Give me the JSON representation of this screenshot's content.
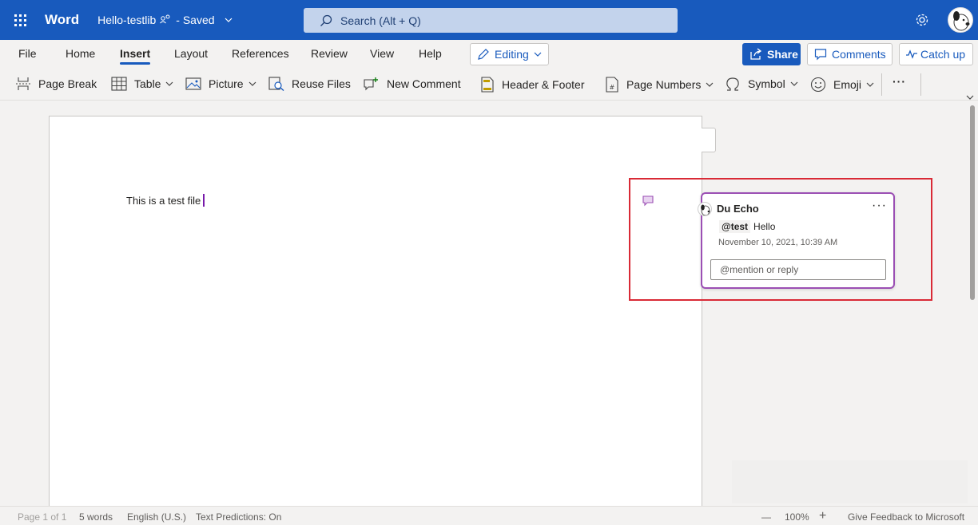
{
  "titlebar": {
    "app_name": "Word",
    "doc_name": "Hello-testlib",
    "save_status": "- Saved",
    "search_placeholder": "Search (Alt + Q)",
    "bg_color": "#185abd"
  },
  "menu": {
    "tabs": [
      {
        "label": "File"
      },
      {
        "label": "Home"
      },
      {
        "label": "Insert",
        "active": true
      },
      {
        "label": "Layout"
      },
      {
        "label": "References"
      },
      {
        "label": "Review"
      },
      {
        "label": "View"
      },
      {
        "label": "Help"
      }
    ],
    "editing_label": "Editing",
    "share_label": "Share",
    "comments_label": "Comments",
    "catchup_label": "Catch up"
  },
  "ribbon": {
    "items": [
      {
        "label": "Page Break",
        "icon": "page-break-icon"
      },
      {
        "label": "Table",
        "icon": "table-icon"
      },
      {
        "label": "Picture",
        "icon": "picture-icon"
      },
      {
        "label": "Reuse Files",
        "icon": "reuse-files-icon"
      },
      {
        "label": "New Comment",
        "icon": "new-comment-icon"
      },
      {
        "label": "Header & Footer",
        "icon": "header-footer-icon"
      },
      {
        "label": "Page Numbers",
        "icon": "page-numbers-icon"
      },
      {
        "label": "Symbol",
        "icon": "omega-icon"
      },
      {
        "label": "Emoji",
        "icon": "smiley-icon"
      }
    ],
    "more_label": "···"
  },
  "document": {
    "body_text": "This is a test file"
  },
  "comment": {
    "author": "Du Echo",
    "mention": "@test",
    "text": "Hello",
    "timestamp": "November 10, 2021, 10:39 AM",
    "reply_placeholder": "@mention or reply",
    "more_label": "···",
    "accent_color": "#9b4fb4",
    "highlight_color": "#d92a36"
  },
  "statusbar": {
    "page": "Page 1 of 1",
    "words": "5 words",
    "language": "English (U.S.)",
    "predictions": "Text Predictions: On",
    "zoom_out": "—",
    "zoom": "100%",
    "zoom_in": "+",
    "feedback": "Give Feedback to Microsoft"
  }
}
